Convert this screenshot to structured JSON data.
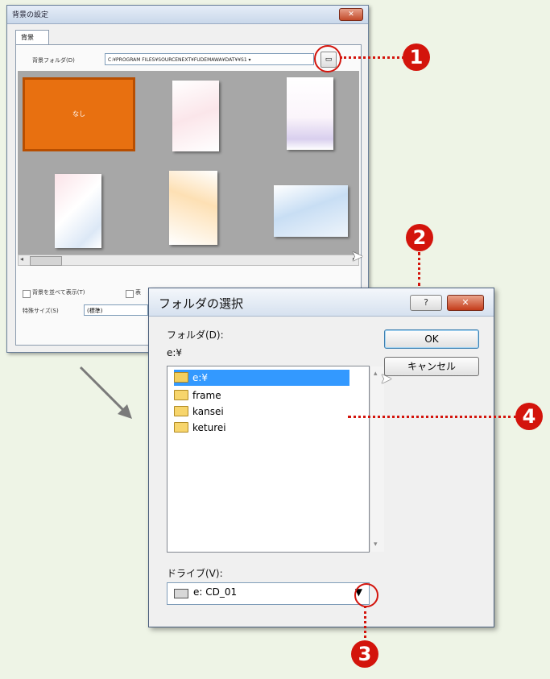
{
  "background_dialog": {
    "title": "背景の設定",
    "close_label": "✕",
    "tab_label": "背景",
    "folder_label": "背景フォルダ(D)",
    "folder_path": "C:¥PROGRAM FILES¥SOURCENEXT¥FUDEMAWA¥DAT¥¥S1 ▾",
    "browse_icon": "folder-open-icon",
    "thumbnails": [
      {
        "label": "なし",
        "selected": true
      },
      {
        "label": ""
      },
      {
        "label": ""
      },
      {
        "label": ""
      },
      {
        "label": ""
      },
      {
        "label": ""
      }
    ],
    "show_all_label": "背景を並べて表示(T)",
    "special_size_label": "特殊サイズ(S)",
    "special_size_value": "(標準)",
    "checkbox2_label": "表"
  },
  "folder_dialog": {
    "title": "フォルダの選択",
    "help_label": "?",
    "close_label": "✕",
    "folder_label": "フォルダ(D):",
    "current_path": "e:¥",
    "tree": [
      {
        "label": "e:¥",
        "selected": true,
        "icon": "open-folder-icon"
      },
      {
        "label": "frame",
        "icon": "folder-icon"
      },
      {
        "label": "kansei",
        "icon": "folder-icon"
      },
      {
        "label": "keturei",
        "icon": "folder-icon"
      }
    ],
    "ok_label": "OK",
    "cancel_label": "キャンセル",
    "drive_label": "ドライブ(V):",
    "drive_value": "e: CD_01",
    "drive_icon": "drive-icon"
  },
  "markers": [
    "1",
    "2",
    "3",
    "4"
  ],
  "colors": {
    "marker_red": "#d3140c",
    "selected_thumb": "#e87010",
    "selection_blue": "#3399ff",
    "page_bg": "#eef4e6"
  }
}
